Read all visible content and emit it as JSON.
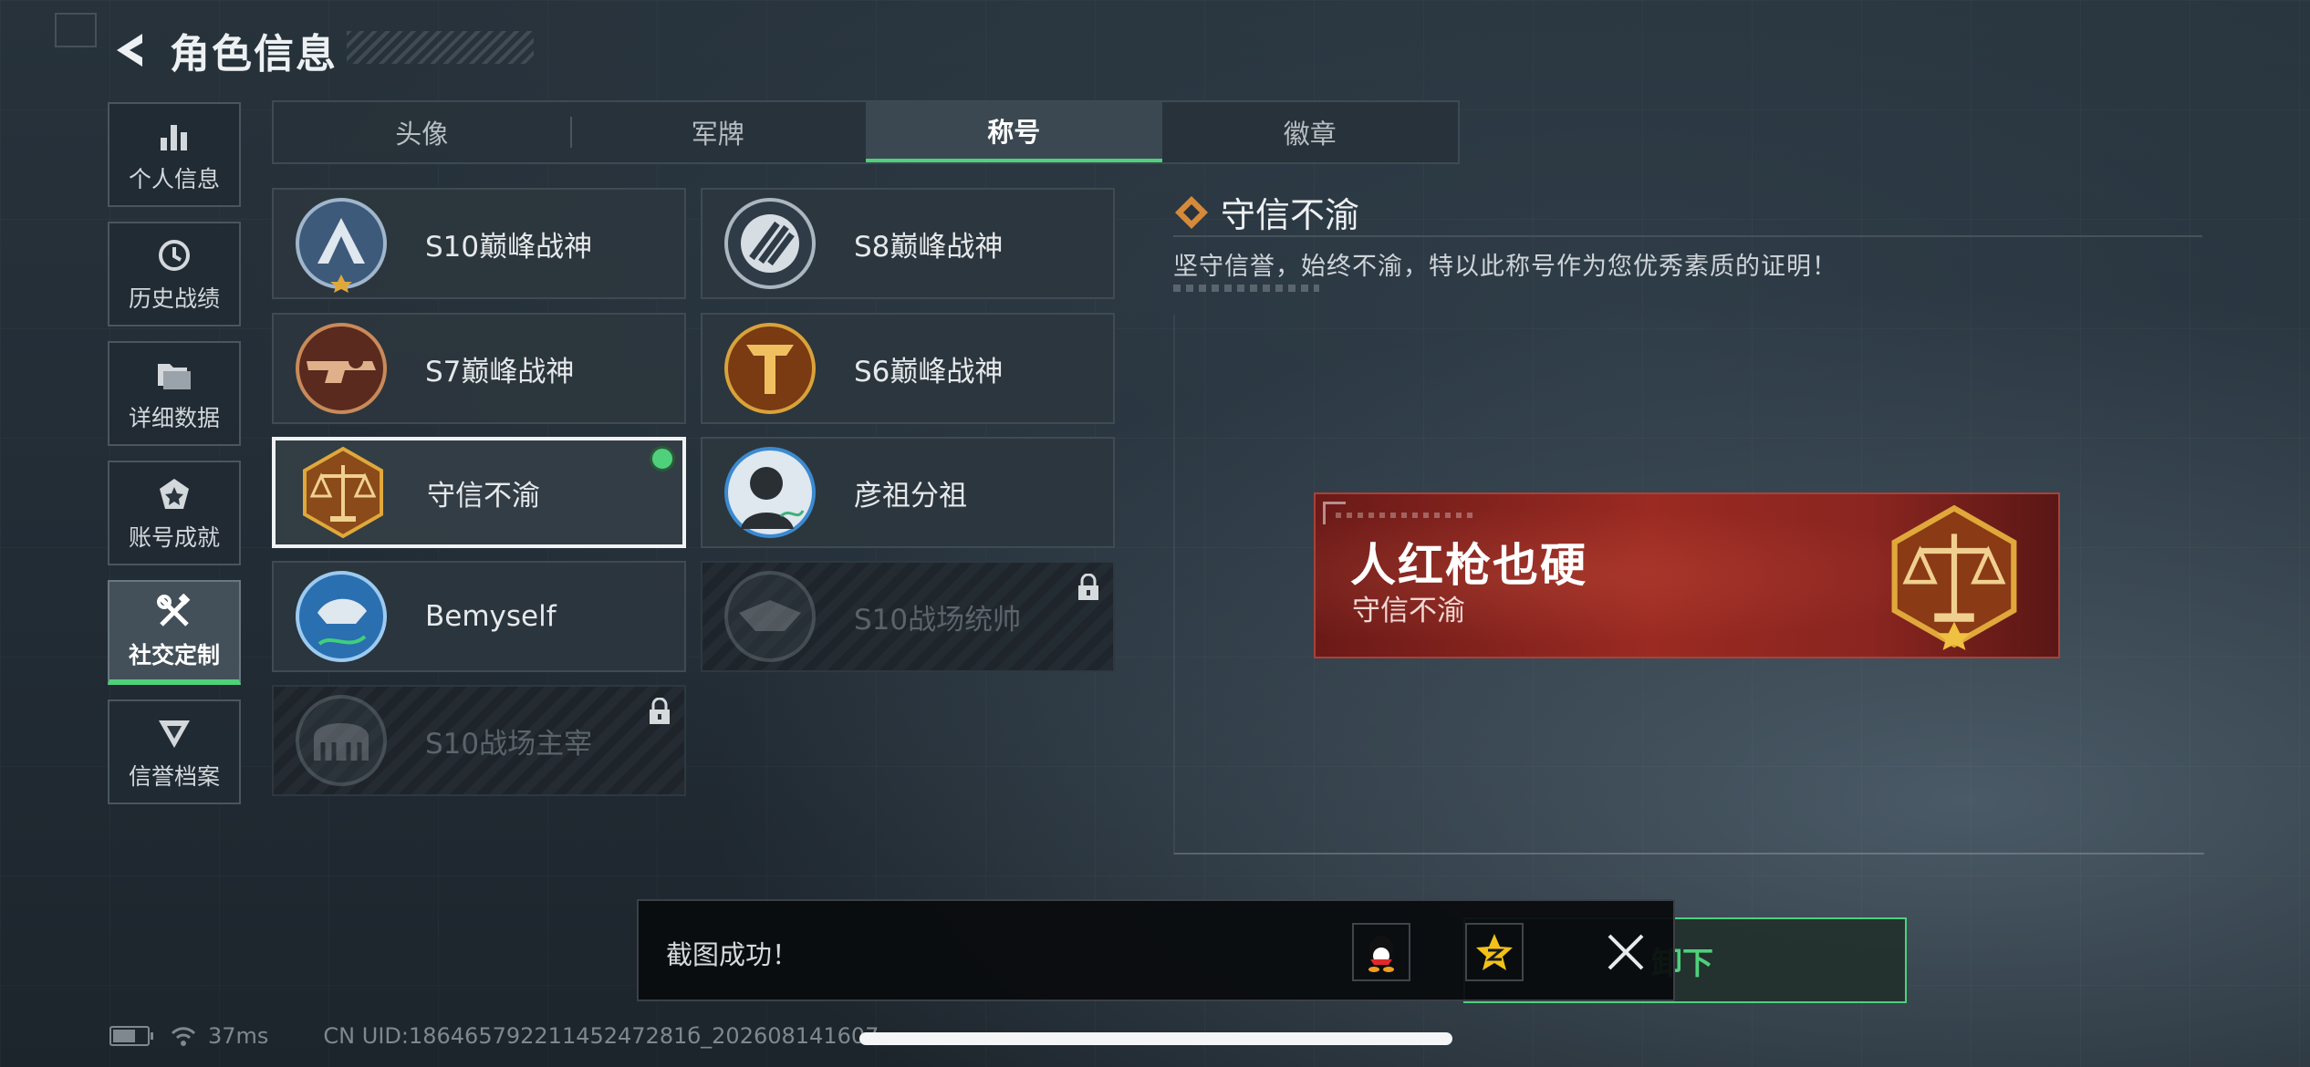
{
  "header": {
    "title": "角色信息"
  },
  "nav": [
    {
      "label": "个人信息",
      "icon": "bar-chart-icon",
      "active": false
    },
    {
      "label": "历史战绩",
      "icon": "history-icon",
      "active": false
    },
    {
      "label": "详细数据",
      "icon": "folder-icon",
      "active": false
    },
    {
      "label": "账号成就",
      "icon": "achievement-icon",
      "active": false
    },
    {
      "label": "社交定制",
      "icon": "tools-icon",
      "active": true
    },
    {
      "label": "信誉档案",
      "icon": "credit-icon",
      "active": false
    }
  ],
  "tabs": [
    {
      "label": "头像",
      "active": false
    },
    {
      "label": "军牌",
      "active": false
    },
    {
      "label": "称号",
      "active": true
    },
    {
      "label": "徽章",
      "active": false
    }
  ],
  "titles": [
    {
      "name": "S10巅峰战神",
      "emblem": "s10-peak-emblem-icon",
      "state": "normal"
    },
    {
      "name": "S8巅峰战神",
      "emblem": "s8-peak-emblem-icon",
      "state": "normal"
    },
    {
      "name": "S7巅峰战神",
      "emblem": "s7-peak-emblem-icon",
      "state": "normal"
    },
    {
      "name": "S6巅峰战神",
      "emblem": "s6-peak-emblem-icon",
      "state": "normal"
    },
    {
      "name": "守信不渝",
      "emblem": "scales-emblem-icon",
      "state": "selected"
    },
    {
      "name": "彦祖分祖",
      "emblem": "portrait-emblem-icon",
      "state": "normal"
    },
    {
      "name": "Bemyself",
      "emblem": "bemyself-emblem-icon",
      "state": "normal"
    },
    {
      "name": "S10战场统帅",
      "emblem": "s10-commander-emblem-icon",
      "state": "locked"
    },
    {
      "name": "S10战场主宰",
      "emblem": "s10-dominator-emblem-icon",
      "state": "locked"
    }
  ],
  "detail": {
    "title": "守信不渝",
    "description": "坚守信誉，始终不渝，特以此称号作为您优秀素质的证明！",
    "banner_name": "人红枪也硬",
    "banner_title": "守信不渝"
  },
  "unequip_label": "卸下",
  "toast": {
    "message": "截图成功！"
  },
  "status": {
    "ping": "37ms",
    "uid": "CN UID:18646579221145247281б_202608141607"
  },
  "colors": {
    "accent": "#4fd07a",
    "banner": "#8a2520",
    "gold": "#d59a3a"
  }
}
